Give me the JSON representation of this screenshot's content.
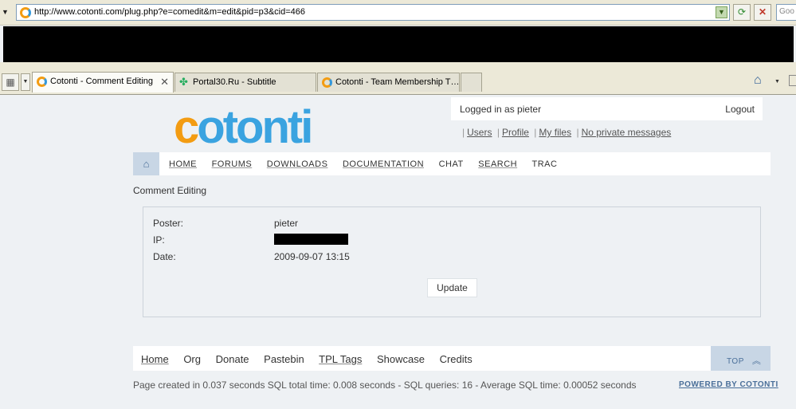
{
  "browser": {
    "url": "http://www.cotonti.com/plug.php?e=comedit&m=edit&pid=p3&cid=466",
    "search_placeholder": "Goo",
    "tabs": [
      {
        "label": "Cotonti - Comment Editing",
        "active": true,
        "icon": "cotonti-favicon"
      },
      {
        "label": "Portal30.Ru - Subtitle",
        "active": false,
        "icon": "clover-favicon"
      },
      {
        "label": "Cotonti - Team Membership T…",
        "active": false,
        "icon": "cotonti-favicon"
      }
    ]
  },
  "header": {
    "logo_text": {
      "part1": "c",
      "part2": "o",
      "part3": "tonti"
    },
    "logged_in": "Logged in as pieter",
    "logout": "Logout",
    "user_links": [
      "Users",
      "Profile",
      "My files",
      "No private messages"
    ]
  },
  "nav": {
    "items": [
      "HOME",
      "FORUMS",
      "DOWNLOADS",
      "DOCUMENTATION",
      "CHAT",
      "SEARCH",
      "TRAC"
    ]
  },
  "main": {
    "title": "Comment Editing",
    "fields": {
      "poster_label": "Poster:",
      "poster_value": "pieter",
      "ip_label": "IP:",
      "date_label": "Date:",
      "date_value": "2009-09-07 13:15"
    },
    "update_button": "Update"
  },
  "footer": {
    "links": [
      "Home",
      "Org",
      "Donate",
      "Pastebin",
      "TPL Tags",
      "Showcase",
      "Credits"
    ],
    "top": "TOP",
    "stats": "Page created in 0.037 seconds SQL total time: 0.008 seconds - SQL queries: 16 - Average SQL time: 0.00052 seconds",
    "powered": "POWERED BY COTONTI"
  },
  "colors": {
    "accent": "#4a6f99",
    "nav_highlight": "#c8d6e5",
    "logo_orange": "#f39c12",
    "logo_blue": "#3aa3e0"
  }
}
